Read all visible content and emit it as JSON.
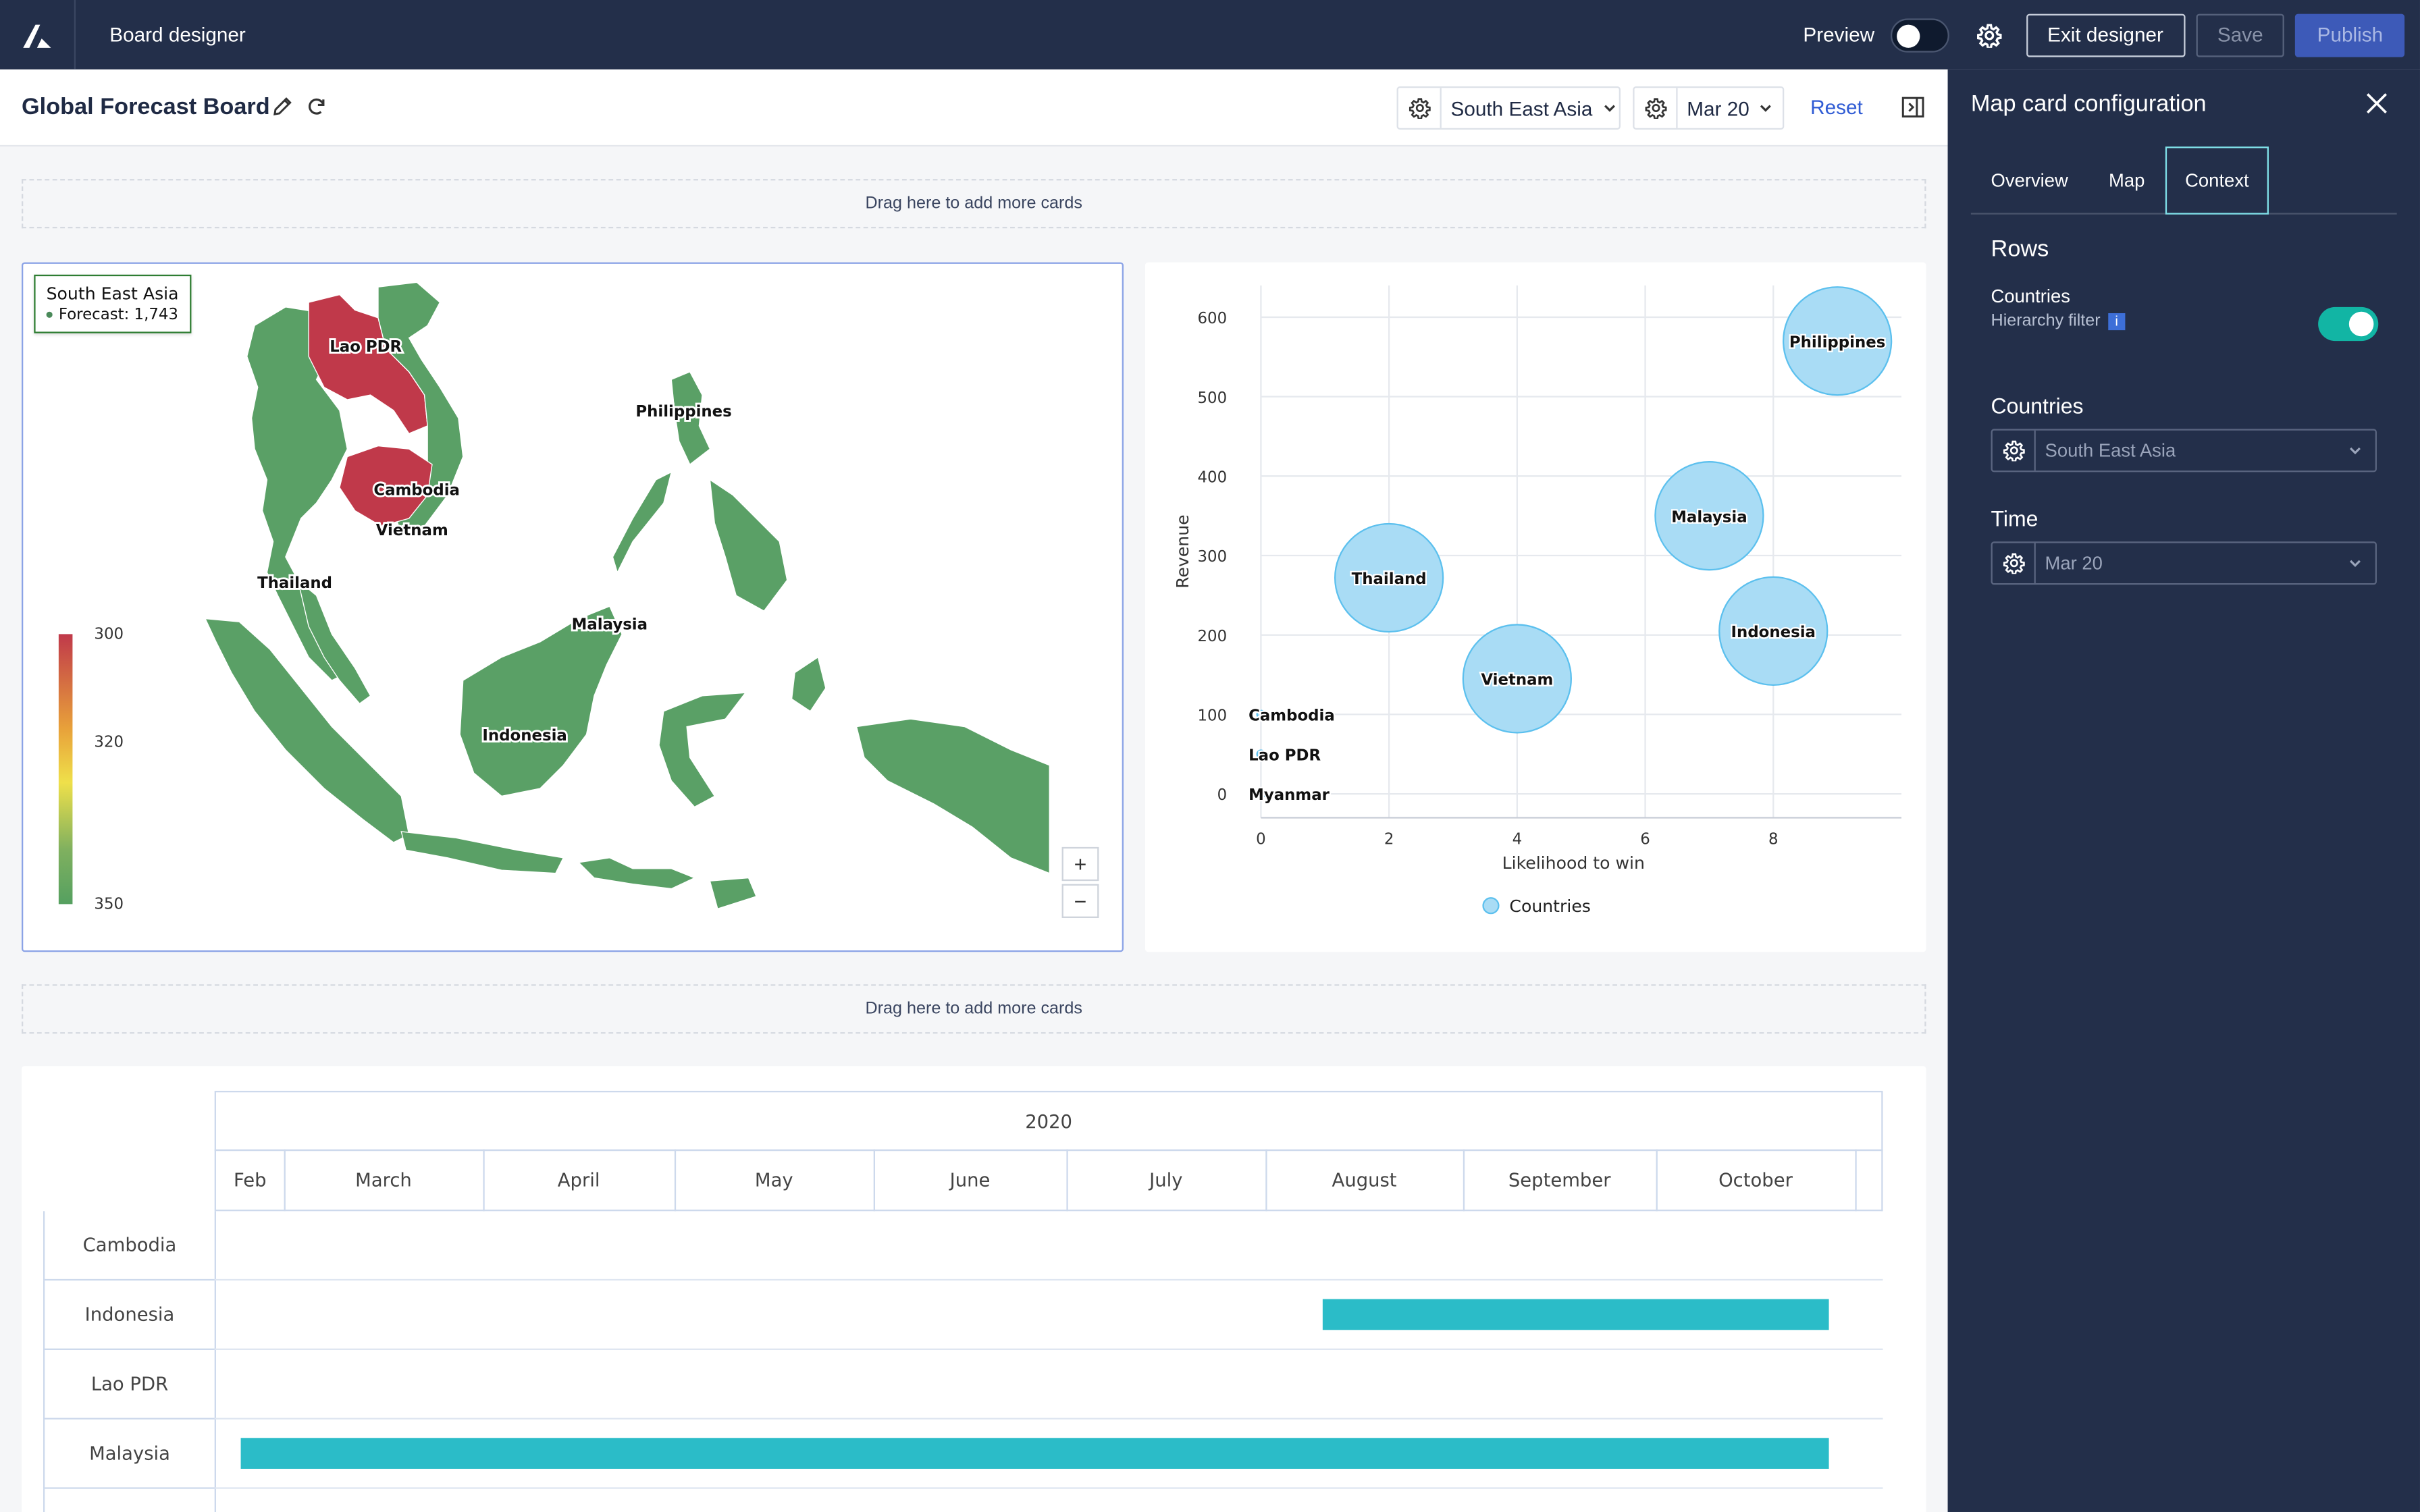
{
  "topbar": {
    "app_title": "Board designer",
    "preview_label": "Preview",
    "exit_label": "Exit designer",
    "save_label": "Save",
    "publish_label": "Publish"
  },
  "board": {
    "title": "Global Forecast Board",
    "filter_region": "South East Asia",
    "filter_time": "Mar 20",
    "reset_label": "Reset"
  },
  "dropzone_label": "Drag here to add more cards",
  "map_card": {
    "tooltip_title": "South East Asia",
    "tooltip_line": "Forecast: 1,743",
    "legend_labels": [
      "300",
      "320",
      "350"
    ],
    "country_labels": [
      "Lao PDR",
      "Philippines",
      "Cambodia",
      "Vietnam",
      "Thailand",
      "Malaysia",
      "Indonesia"
    ],
    "zoom_in": "+",
    "zoom_out": "−",
    "highlight_color": "#c0394a",
    "base_color": "#5aa066"
  },
  "chart_data": {
    "type": "scatter",
    "xlabel": "Likelihood to win",
    "ylabel": "Revenue",
    "xlim": [
      0,
      10
    ],
    "ylim": [
      -30,
      640
    ],
    "x_ticks": [
      "0",
      "2",
      "4",
      "6",
      "8"
    ],
    "y_ticks": [
      "0",
      "100",
      "200",
      "300",
      "400",
      "500",
      "600"
    ],
    "legend": "Countries",
    "grid": true,
    "points": [
      {
        "label": "Philippines",
        "x": 9,
        "y": 570,
        "size": 1
      },
      {
        "label": "Malaysia",
        "x": 7,
        "y": 350,
        "size": 1
      },
      {
        "label": "Thailand",
        "x": 2,
        "y": 272,
        "size": 1
      },
      {
        "label": "Indonesia",
        "x": 8,
        "y": 205,
        "size": 1
      },
      {
        "label": "Vietnam",
        "x": 4,
        "y": 145,
        "size": 1
      },
      {
        "label": "Cambodia",
        "x": 0,
        "y": 100,
        "size": 0.05
      },
      {
        "label": "Lao PDR",
        "x": 0,
        "y": 50,
        "size": 0.05
      },
      {
        "label": "Myanmar",
        "x": 0,
        "y": 0,
        "size": 0.05
      }
    ]
  },
  "gantt": {
    "year": "2020",
    "months": [
      "Feb",
      "March",
      "April",
      "May",
      "June",
      "July",
      "August",
      "September",
      "October"
    ],
    "rows": [
      {
        "label": "Cambodia"
      },
      {
        "label": "Indonesia",
        "start": "2020-08-10",
        "end": "2020-10-28"
      },
      {
        "label": "Lao PDR"
      },
      {
        "label": "Malaysia",
        "start": "2020-02-12",
        "end": "2020-10-28"
      }
    ]
  },
  "panel": {
    "title": "Map card configuration",
    "tabs": [
      "Overview",
      "Map",
      "Context"
    ],
    "active_tab": "Context",
    "rows_heading": "Rows",
    "countries_label": "Countries",
    "hierarchy_label": "Hierarchy filter",
    "countries_heading": "Countries",
    "countries_value": "South East Asia",
    "time_heading": "Time",
    "time_value": "Mar 20"
  }
}
